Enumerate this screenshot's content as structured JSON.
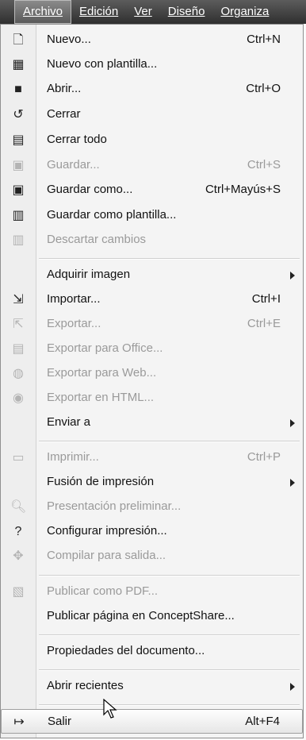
{
  "menubar": {
    "items": [
      "Archivo",
      "Edición",
      "Ver",
      "Diseño",
      "Organiza"
    ]
  },
  "menu": {
    "items": [
      {
        "label": "Nuevo...",
        "shortcut": "Ctrl+N",
        "icon": "new-document-icon",
        "glyph": "🗋"
      },
      {
        "label": "Nuevo con plantilla...",
        "shortcut": "",
        "icon": "new-from-template-icon",
        "glyph": "▦"
      },
      {
        "label": "Abrir...",
        "shortcut": "Ctrl+O",
        "icon": "folder-icon",
        "glyph": "■"
      },
      {
        "label": "Cerrar",
        "shortcut": "",
        "icon": "close-document-icon",
        "glyph": "↺"
      },
      {
        "label": "Cerrar todo",
        "shortcut": "",
        "icon": "close-all-icon",
        "glyph": "▤"
      },
      {
        "label": "Guardar...",
        "shortcut": "Ctrl+S",
        "icon": "save-icon",
        "glyph": "▣"
      },
      {
        "label": "Guardar como...",
        "shortcut": "Ctrl+Mayús+S",
        "icon": "save-as-icon",
        "glyph": "▣"
      },
      {
        "label": "Guardar como plantilla...",
        "shortcut": "",
        "icon": "save-template-icon",
        "glyph": "▥"
      },
      {
        "label": "Descartar cambios",
        "shortcut": "",
        "icon": "revert-icon",
        "glyph": "▥"
      },
      {
        "label": "Adquirir imagen",
        "shortcut": "",
        "icon": "",
        "glyph": ""
      },
      {
        "label": "Importar...",
        "shortcut": "Ctrl+I",
        "icon": "import-icon",
        "glyph": "⇲"
      },
      {
        "label": "Exportar...",
        "shortcut": "Ctrl+E",
        "icon": "export-icon",
        "glyph": "⇱"
      },
      {
        "label": "Exportar para Office...",
        "shortcut": "",
        "icon": "export-office-icon",
        "glyph": "▤"
      },
      {
        "label": "Exportar para Web...",
        "shortcut": "",
        "icon": "export-web-icon",
        "glyph": "◍"
      },
      {
        "label": "Exportar en HTML...",
        "shortcut": "",
        "icon": "export-html-icon",
        "glyph": "◉"
      },
      {
        "label": "Enviar a",
        "shortcut": "",
        "icon": "",
        "glyph": ""
      },
      {
        "label": "Imprimir...",
        "shortcut": "Ctrl+P",
        "icon": "printer-icon",
        "glyph": "▭"
      },
      {
        "label": "Fusión de impresión",
        "shortcut": "",
        "icon": "",
        "glyph": ""
      },
      {
        "label": "Presentación preliminar...",
        "shortcut": "",
        "icon": "print-preview-icon",
        "glyph": "🔍︎"
      },
      {
        "label": "Configurar impresión...",
        "shortcut": "",
        "icon": "print-setup-icon",
        "glyph": "?"
      },
      {
        "label": "Compilar para salida...",
        "shortcut": "",
        "icon": "prepare-output-icon",
        "glyph": "✥"
      },
      {
        "label": "Publicar como PDF...",
        "shortcut": "",
        "icon": "pdf-icon",
        "glyph": "▧"
      },
      {
        "label": "Publicar página en ConceptShare...",
        "shortcut": "",
        "icon": "",
        "glyph": ""
      },
      {
        "label": "Propiedades del documento...",
        "shortcut": "",
        "icon": "",
        "glyph": ""
      },
      {
        "label": "Abrir recientes",
        "shortcut": "",
        "icon": "",
        "glyph": ""
      },
      {
        "label": "Salir",
        "shortcut": "Alt+F4",
        "icon": "exit-icon",
        "glyph": "↦"
      }
    ]
  }
}
